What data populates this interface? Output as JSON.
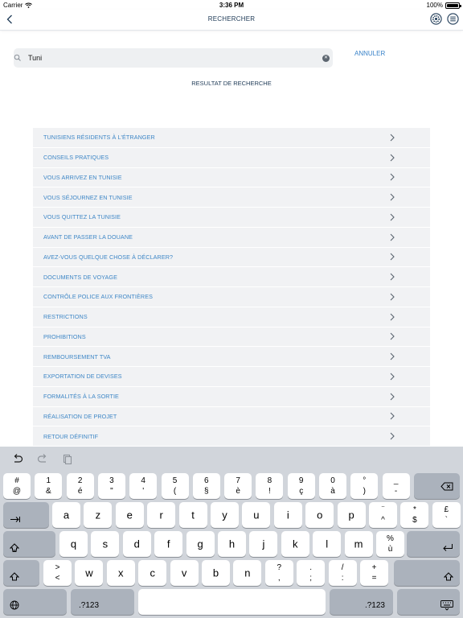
{
  "status_bar": {
    "carrier": "Carrier",
    "time": "3:36 PM",
    "battery": "100%"
  },
  "navbar": {
    "title": "RECHERCHER"
  },
  "search": {
    "value": "Tuni",
    "cancel_label": "ANNULER"
  },
  "results": {
    "title": "RESULTAT DE RECHERCHE",
    "items": [
      "TUNISIENS RÉSIDENTS À L'ÉTRANGER",
      "CONSEILS PRATIQUES",
      "VOUS ARRIVEZ EN TUNISIE",
      "VOUS SÉJOURNEZ EN TUNISIE",
      "VOUS QUITTEZ LA TUNISIE",
      "AVANT DE PASSER LA DOUANE",
      "AVEZ-VOUS QUELQUE CHOSE À DÉCLARER?",
      "DOCUMENTS DE VOYAGE",
      "CONTRÔLE POLICE AUX FRONTIÈRES",
      "RESTRICTIONS",
      "PROHIBITIONS",
      "REMBOURSEMENT TVA",
      "EXPORTATION DE DEVISES",
      "FORMALITÉS À LA SORTIE",
      "RÉALISATION DE PROJET",
      "RETOUR DÉFINITIF"
    ]
  },
  "keyboard": {
    "row1": [
      {
        "top": "#",
        "bot": "@"
      },
      {
        "top": "1",
        "bot": "&"
      },
      {
        "top": "2",
        "bot": "é"
      },
      {
        "top": "3",
        "bot": "\""
      },
      {
        "top": "4",
        "bot": "'"
      },
      {
        "top": "5",
        "bot": "("
      },
      {
        "top": "6",
        "bot": "§"
      },
      {
        "top": "7",
        "bot": "è"
      },
      {
        "top": "8",
        "bot": "!"
      },
      {
        "top": "9",
        "bot": "ç"
      },
      {
        "top": "0",
        "bot": "à"
      },
      {
        "top": "°",
        "bot": ")"
      },
      {
        "top": "_",
        "bot": "-"
      }
    ],
    "row2": [
      "a",
      "z",
      "e",
      "r",
      "t",
      "y",
      "u",
      "i",
      "o",
      "p"
    ],
    "row2_extra": [
      {
        "top": "¨",
        "bot": "^"
      },
      {
        "top": "*",
        "bot": "$"
      },
      {
        "top": "£",
        "bot": "`"
      }
    ],
    "row3": [
      "q",
      "s",
      "d",
      "f",
      "g",
      "h",
      "j",
      "k",
      "l",
      "m"
    ],
    "row3_extra": {
      "top": "%",
      "bot": "ù"
    },
    "row4": [
      {
        "top": ">",
        "bot": "<"
      },
      {
        "single": "w"
      },
      {
        "single": "x"
      },
      {
        "single": "c"
      },
      {
        "single": "v"
      },
      {
        "single": "b"
      },
      {
        "single": "n"
      },
      {
        "top": "?",
        "bot": ","
      },
      {
        "top": ".",
        "bot": ";"
      },
      {
        "top": "/",
        "bot": ":"
      },
      {
        "top": "+",
        "bot": "="
      }
    ],
    "numbers_label": ".?123"
  }
}
